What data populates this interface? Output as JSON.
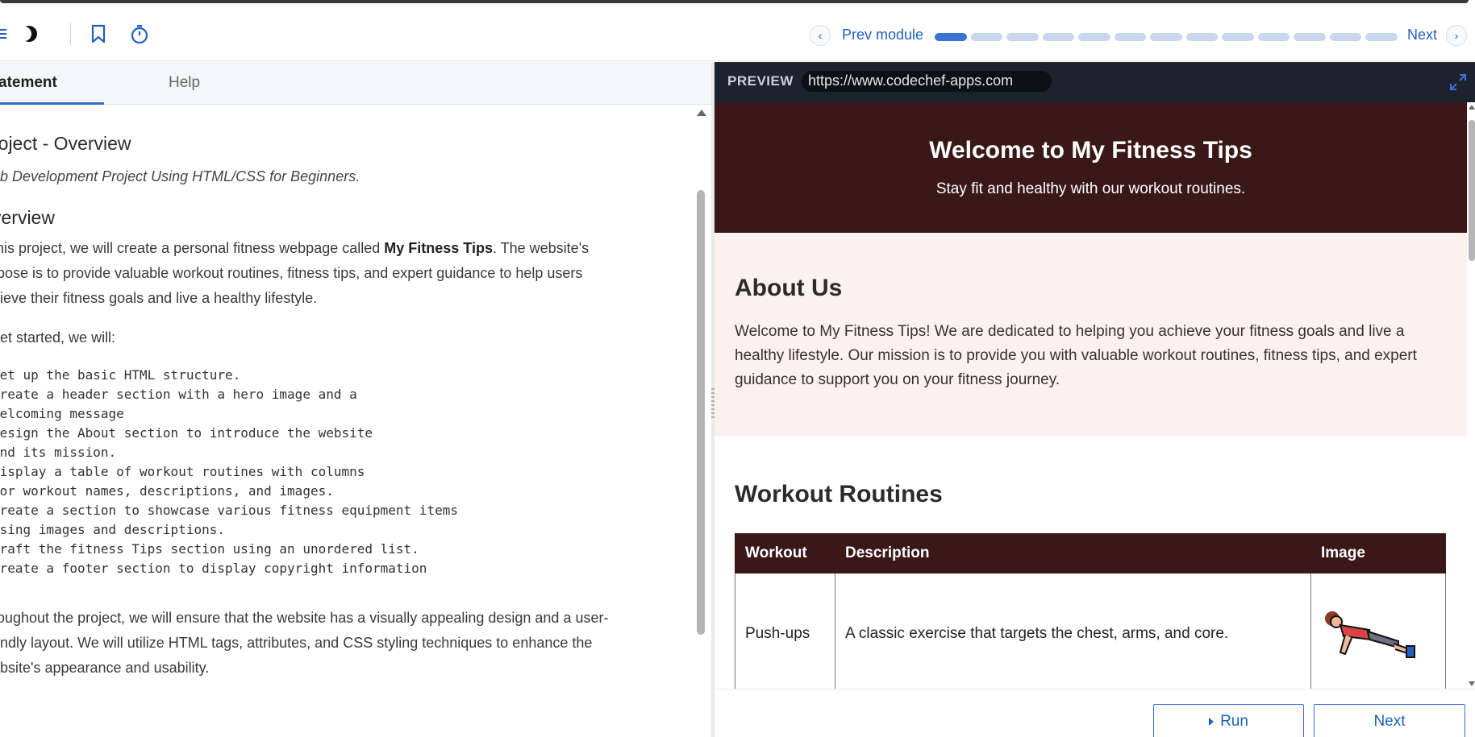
{
  "toolbar": {
    "prev_label": "Prev module",
    "next_label": "Next",
    "progress_total_segments": 13,
    "progress_active_segment": 1,
    "accent_color": "#1f5fbf"
  },
  "left_pane": {
    "tabs": [
      {
        "label": "atement",
        "active": true
      },
      {
        "label": "Help",
        "active": false
      }
    ],
    "title": "roject - Overview",
    "subtitle": "eb Development Project Using HTML/CSS for Beginners.",
    "overview_heading": "verview",
    "intro_pre": "this project, we will create a personal fitness webpage called ",
    "intro_bold": "My Fitness Tips",
    "intro_post": ". The website's",
    "intro_line2": "rpose is to provide valuable workout routines, fitness tips, and expert guidance to help users",
    "intro_line3": "hieve their fitness goals and live a healthy lifestyle.",
    "get_started": " get started, we will:",
    "steps": [
      "Set up the basic HTML structure.",
      "Create a header section with a hero image and a",
      "welcoming message",
      "Design the About section to introduce the website",
      "and its mission.",
      "Display a table of workout routines with columns",
      "for workout names, descriptions, and images.",
      "Create a section to showcase various fitness equipment items",
      "using images and descriptions.",
      "Craft the fitness Tips section using an unordered list.",
      "Create a footer section to display copyright information"
    ],
    "outro_line1": "roughout the project, we will ensure that the website has a visually appealing design and a user-",
    "outro_line2": "endly layout. We will utilize HTML tags, attributes, and CSS styling techniques to enhance the",
    "outro_line3": "ebsite's appearance and usability."
  },
  "preview": {
    "label": "PREVIEW",
    "url": "https://www.codechef-apps.com",
    "hero_title": "Welcome to My Fitness Tips",
    "hero_subtitle": "Stay fit and healthy with our workout routines.",
    "about_heading": "About Us",
    "about_text": "Welcome to My Fitness Tips! We are dedicated to helping you achieve your fitness goals and live a healthy lifestyle. Our mission is to provide you with valuable workout routines, fitness tips, and expert guidance to support you on your fitness journey.",
    "workout_heading": "Workout Routines",
    "table_headers": [
      "Workout",
      "Description",
      "Image"
    ],
    "table_rows": [
      {
        "workout": "Push-ups",
        "description": "A classic exercise that targets the chest, arms, and core."
      }
    ],
    "hero_color": "#3b1818",
    "about_bg": "#fdf1f0"
  },
  "actions": {
    "run_label": "Run",
    "next_label": "Next"
  }
}
